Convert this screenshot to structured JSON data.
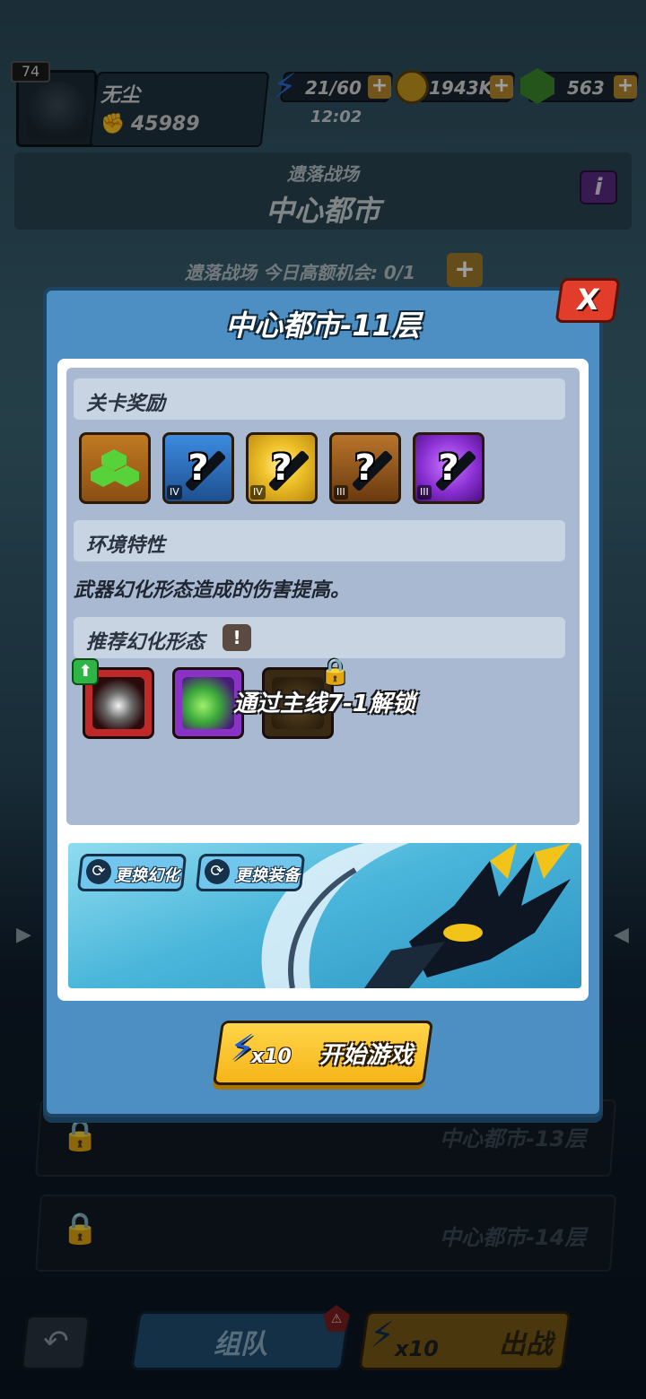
{
  "player": {
    "level": "74",
    "name": "无尘",
    "power": "45989"
  },
  "resources": {
    "energy": "21/60",
    "energy_timer": "12:02",
    "gold": "1943K",
    "gems": "563"
  },
  "stage": {
    "subtitle": "遗落战场",
    "title": "中心都市",
    "info_glyph": "i",
    "chance_text": "遗落战场 今日高额机会: 0/1"
  },
  "floor_list": [
    {
      "label": "中心都市-13层"
    },
    {
      "label": "中心都市-14层"
    }
  ],
  "bottom_bar": {
    "team_label": "组队",
    "fight_cost": "x10",
    "fight_label": "出战"
  },
  "modal": {
    "title": "中心都市-11层",
    "close_glyph": "X",
    "rewards_header": "关卡奖励",
    "rewards": [
      {
        "icon": "green-gem-icon",
        "tier": "",
        "color": "#a8651c"
      },
      {
        "icon": "mystery-weapon-icon",
        "tier": "IV",
        "color": "#2f78c4"
      },
      {
        "icon": "mystery-weapon-icon",
        "tier": "IV",
        "color": "#e0b21a"
      },
      {
        "icon": "mystery-weapon-icon",
        "tier": "III",
        "color": "#9a5a1c"
      },
      {
        "icon": "mystery-weapon-icon",
        "tier": "III",
        "color": "#8f2fd6"
      }
    ],
    "question_glyph": "?",
    "environment_header": "环境特性",
    "environment_desc": "武器幻化形态造成的伤害提高。",
    "recommend_header": "推荐幻化形态",
    "forms": [
      {
        "icon": "antlered-spirit-icon",
        "color": "#c0292a",
        "locked": false
      },
      {
        "icon": "green-serpent-icon",
        "color": "#8a32c8",
        "locked": false
      },
      {
        "icon": "locked-form-icon",
        "color": "#3a2a14",
        "locked": true
      }
    ],
    "unlock_text": "通过主线7-1解锁",
    "swap_form_label": "更换幻化",
    "swap_gear_label": "更换装备",
    "start_cost": "x10",
    "start_label": "开始游戏"
  }
}
